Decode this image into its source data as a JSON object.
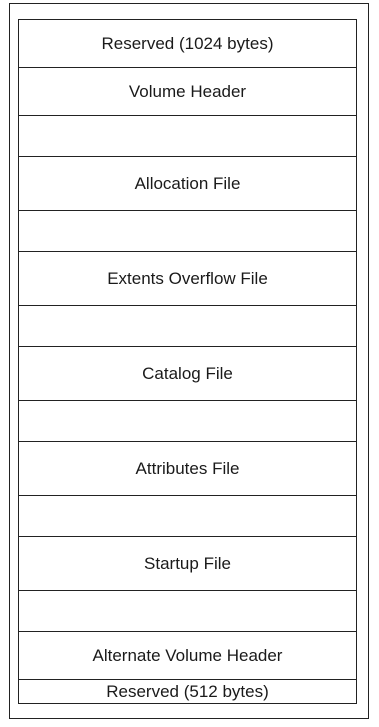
{
  "diagram": {
    "blocks": [
      {
        "label": "Reserved (1024 bytes)"
      },
      {
        "label": "Volume Header"
      },
      {
        "label": ""
      },
      {
        "label": "Allocation File"
      },
      {
        "label": ""
      },
      {
        "label": "Extents Overflow File"
      },
      {
        "label": ""
      },
      {
        "label": "Catalog File"
      },
      {
        "label": ""
      },
      {
        "label": "Attributes File"
      },
      {
        "label": ""
      },
      {
        "label": "Startup File"
      },
      {
        "label": ""
      },
      {
        "label": "Alternate Volume Header"
      },
      {
        "label": "Reserved (512 bytes)"
      }
    ]
  }
}
